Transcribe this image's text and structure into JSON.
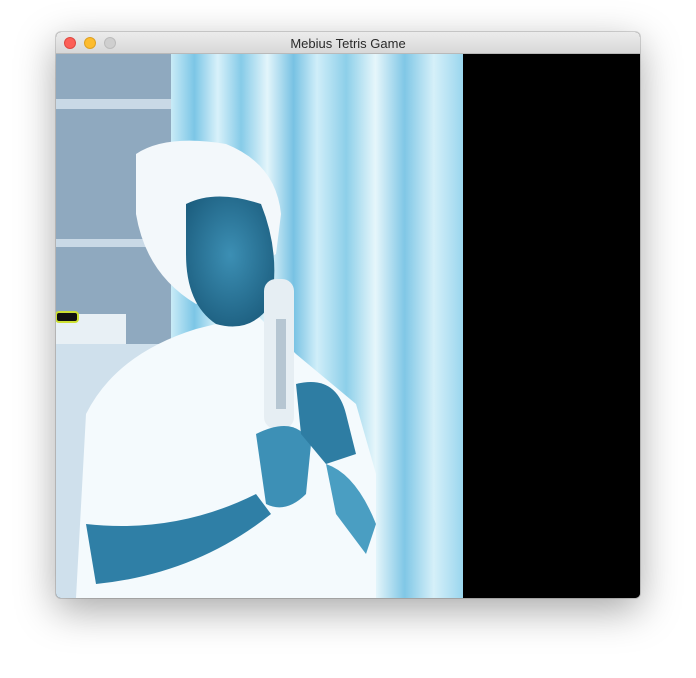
{
  "window": {
    "title": "Mebius Tetris Game"
  },
  "controls": {
    "close": "close-button",
    "minimize": "minimize-button",
    "zoom": "zoom-button"
  },
  "colors": {
    "background_panel": "#000000",
    "stripe": "#8fd0ea",
    "skin": "#3f8fb3"
  }
}
